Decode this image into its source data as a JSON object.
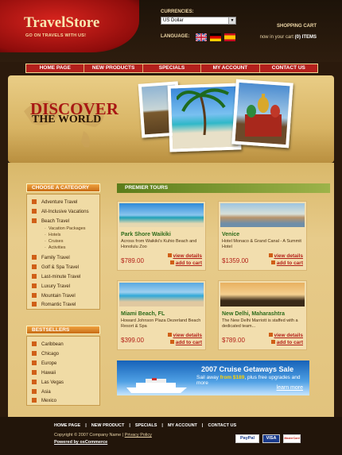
{
  "header": {
    "logo": "TravelStore",
    "tagline": "GO ON TRAVELS WITH US!",
    "currencies_label": "CURRENCIES:",
    "currency_value": "US Dollar",
    "language_label": "LANGUAGE:",
    "cart_title": "SHOPPING CART",
    "cart_line": "now in your cart",
    "cart_count": "(0) ITEMS"
  },
  "nav": [
    "HOME PAGE",
    "NEW PRODUCTS",
    "SPECIALS",
    "MY ACCOUNT",
    "CONTACT US"
  ],
  "banner": {
    "line1": "DISCOVER",
    "line2": "THE WORLD"
  },
  "categories": {
    "title": "CHOOSE A CATEGORY",
    "items": [
      "Adventure Travel",
      "All-Inclusive Vacations",
      "Beach Travel",
      "Family Travel",
      "Golf & Spa Travel",
      "Last-minute Travel",
      "Luxury Travel",
      "Mountain Travel",
      "Romantic Travel"
    ],
    "subitems": [
      "Vacation Packages",
      "Hotels",
      "Cruises",
      "Activities"
    ]
  },
  "bestsellers": {
    "title": "BESTSELLERS",
    "items": [
      "Caribbean",
      "Chicago",
      "Europe",
      "Hawaii",
      "Las Vegas",
      "Asia",
      "Mexico"
    ]
  },
  "tours": {
    "title": "PREMIER TOURS",
    "details_label": "view details",
    "cart_label": "add to cart",
    "items": [
      {
        "name": "Park Shore Waikiki",
        "desc": "Across from Waikiki's Kuhio Beach and Honolulu Zoo",
        "price": "$789.00"
      },
      {
        "name": "Venice",
        "desc": "Hotel Monaco & Grand Canal - A Summit Hotel",
        "price": "$1359.00"
      },
      {
        "name": "Miami Beach, FL",
        "desc": "Howard Johnson Plaza Dezerland Beach Resort & Spa",
        "price": "$399.00"
      },
      {
        "name": "New Delhi, Maharashtra",
        "desc": "The New Delhi Marriott is staffed with a dedicated team...",
        "price": "$789.00"
      }
    ]
  },
  "promo": {
    "title": "2007 Cruise Getaways Sale",
    "sub_prefix": "Sail away",
    "sub_price": "from $189",
    "sub_suffix": ", plus free upgrades and more",
    "learn": "learn more"
  },
  "footer": {
    "links": [
      "HOME PAGE",
      "NEW PRODUCT",
      "SPECIALS",
      "MY ACCOUNT",
      "CONTACT US"
    ],
    "copyright": "Copyright © 2007 Company Name",
    "privacy": "Privacy Policy",
    "powered": "Powered by osCommerce",
    "payments": [
      "PayPal",
      "VISA",
      "MasterCard"
    ]
  },
  "colors": {
    "brand_red": "#b3201c",
    "accent_orange": "#d05f17",
    "green": "#2e6b1a"
  }
}
